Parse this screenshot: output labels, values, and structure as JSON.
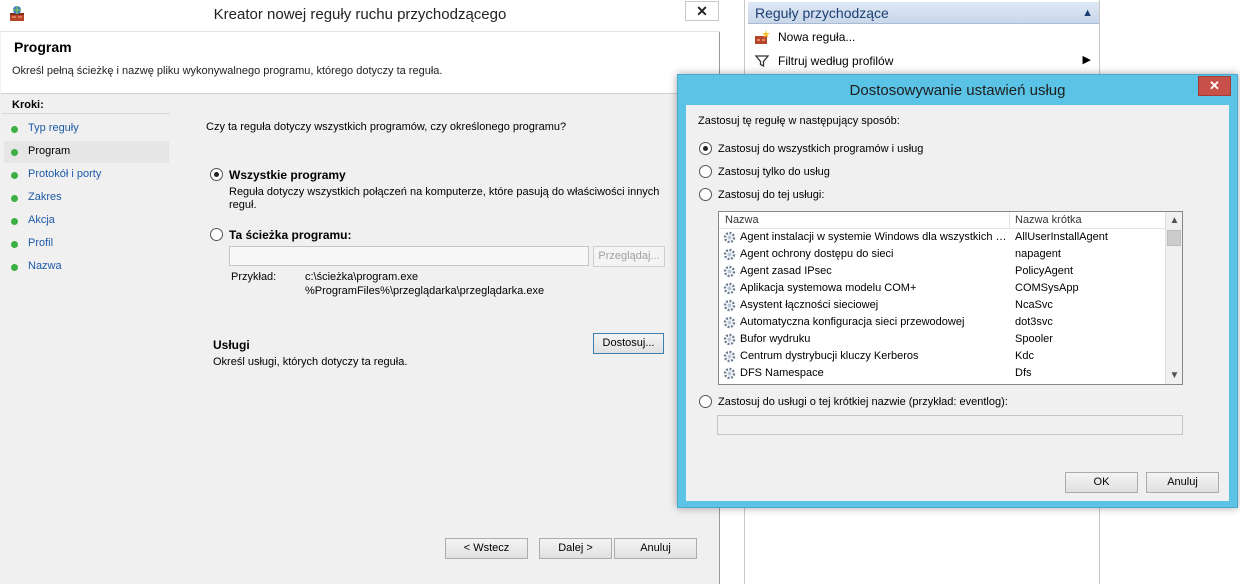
{
  "wizard": {
    "title": "Kreator nowej reguły ruchu przychodzącego",
    "close_glyph": "✕",
    "header_title": "Program",
    "header_desc": "Określ pełną ścieżkę i nazwę pliku wykonywalnego programu, którego dotyczy ta reguła.",
    "steps_label": "Kroki:",
    "steps": [
      {
        "label": "Typ reguły",
        "active": false
      },
      {
        "label": "Program",
        "active": true
      },
      {
        "label": "Protokół i porty",
        "active": false
      },
      {
        "label": "Zakres",
        "active": false
      },
      {
        "label": "Akcja",
        "active": false
      },
      {
        "label": "Profil",
        "active": false
      },
      {
        "label": "Nazwa",
        "active": false
      }
    ],
    "question": "Czy ta reguła dotyczy wszystkich programów, czy określonego programu?",
    "all_programs": {
      "label": "Wszystkie programy",
      "desc_line1": "Reguła dotyczy wszystkich połączeń na komputerze, które pasują do właściwości innych",
      "desc_line2": "reguł.",
      "checked": true
    },
    "program_path": {
      "label": "Ta ścieżka programu:",
      "value": "",
      "browse_label": "Przeglądaj...",
      "example_label": "Przykład:",
      "example_line1": "c:\\ścieżka\\program.exe",
      "example_line2": "%ProgramFiles%\\przeglądarka\\przeglądarka.exe",
      "checked": false
    },
    "services": {
      "title": "Usługi",
      "desc": "Określ usługi, których dotyczy ta reguła.",
      "customize_label": "Dostosuj..."
    },
    "buttons": {
      "back": "< Wstecz",
      "next": "Dalej >",
      "cancel": "Anuluj"
    }
  },
  "actions": {
    "header": "Reguły przychodzące",
    "items": [
      {
        "label": "Nowa reguła...",
        "icon": "new-rule-icon"
      },
      {
        "label": "Filtruj według profilów",
        "icon": "filter-icon"
      }
    ]
  },
  "dialog": {
    "title": "Dostosowywanie ustawień usług",
    "close_glyph": "✕",
    "prompt": "Zastosuj tę regułę w następujący sposób:",
    "options": [
      {
        "label": "Zastosuj do wszystkich programów i usług",
        "checked": true
      },
      {
        "label": "Zastosuj tylko do usług",
        "checked": false
      },
      {
        "label": "Zastosuj do tej usługi:",
        "checked": false
      }
    ],
    "columns": {
      "name": "Nazwa",
      "short": "Nazwa krótka"
    },
    "services": [
      {
        "name": "Agent instalacji w systemie Windows dla wszystkich użytkowników",
        "short": "AllUserInstallAgent"
      },
      {
        "name": "Agent ochrony dostępu do sieci",
        "short": "napagent"
      },
      {
        "name": "Agent zasad IPsec",
        "short": "PolicyAgent"
      },
      {
        "name": "Aplikacja systemowa modelu COM+",
        "short": "COMSysApp"
      },
      {
        "name": "Asystent łączności sieciowej",
        "short": "NcaSvc"
      },
      {
        "name": "Automatyczna konfiguracja sieci przewodowej",
        "short": "dot3svc"
      },
      {
        "name": "Bufor wydruku",
        "short": "Spooler"
      },
      {
        "name": "Centrum dystrybucji kluczy Kerberos",
        "short": "Kdc"
      },
      {
        "name": "DFS Namespace",
        "short": "Dfs"
      }
    ],
    "short_name_option": {
      "label": "Zastosuj do usługi o tej krótkiej nazwie (przykład: eventlog):",
      "checked": false,
      "value": ""
    },
    "buttons": {
      "ok": "OK",
      "cancel": "Anuluj"
    }
  }
}
